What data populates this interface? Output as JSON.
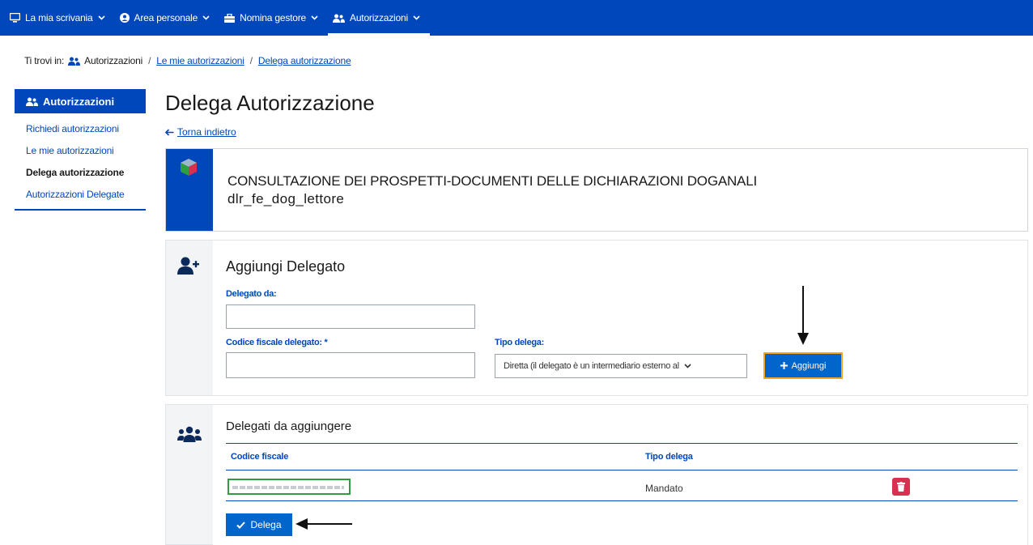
{
  "topnav": {
    "items": [
      {
        "label": "La mia scrivania",
        "icon": "monitor-icon"
      },
      {
        "label": "Area personale",
        "icon": "user-circle-icon"
      },
      {
        "label": "Nomina gestore",
        "icon": "briefcase-icon"
      },
      {
        "label": "Autorizzazioni",
        "icon": "users-icon"
      }
    ],
    "active_index": 3,
    "background": "#0047bb"
  },
  "breadcrumb": {
    "prefix": "Ti trovi in:",
    "root": "Autorizzazioni",
    "level2": "Le mie autorizzazioni",
    "level3": "Delega autorizzazione",
    "separator": "/"
  },
  "sidebar": {
    "title": "Autorizzazioni",
    "items": [
      {
        "label": "Richiedi autorizzazioni",
        "active": false
      },
      {
        "label": "Le mie autorizzazioni",
        "active": false
      },
      {
        "label": "Delega autorizzazione",
        "active": true
      },
      {
        "label": "Autorizzazioni Delegate",
        "active": false
      }
    ]
  },
  "main": {
    "title": "Delega Autorizzazione",
    "back_label": "Torna indietro"
  },
  "service": {
    "name": "CONSULTAZIONE DEI PROSPETTI-DOCUMENTI DELLE DICHIARAZIONI DOGANALI",
    "code": "dlr_fe_dog_lettore"
  },
  "add_delegate": {
    "title": "Aggiungi Delegato",
    "delegated_by_label": "Delegato da:",
    "delegated_by_value": "",
    "fiscal_code_label": "Codice fiscale delegato: *",
    "fiscal_code_value": "",
    "type_label": "Tipo delega:",
    "type_selected": "Diretta (il delegato è un intermediario esterno al",
    "add_button": "Aggiungi"
  },
  "delegates_list": {
    "title": "Delegati da aggiungere",
    "columns": [
      "Codice fiscale",
      "Tipo delega"
    ],
    "rows": [
      {
        "codice_fiscale": "",
        "tipo_delega": "Mandato"
      }
    ],
    "submit_button": "Delega"
  },
  "colors": {
    "primary": "#0047bb",
    "button": "#0066cc",
    "highlight_orange": "#f5a623",
    "highlight_green": "#2e9e3e",
    "danger": "#d9304f"
  }
}
